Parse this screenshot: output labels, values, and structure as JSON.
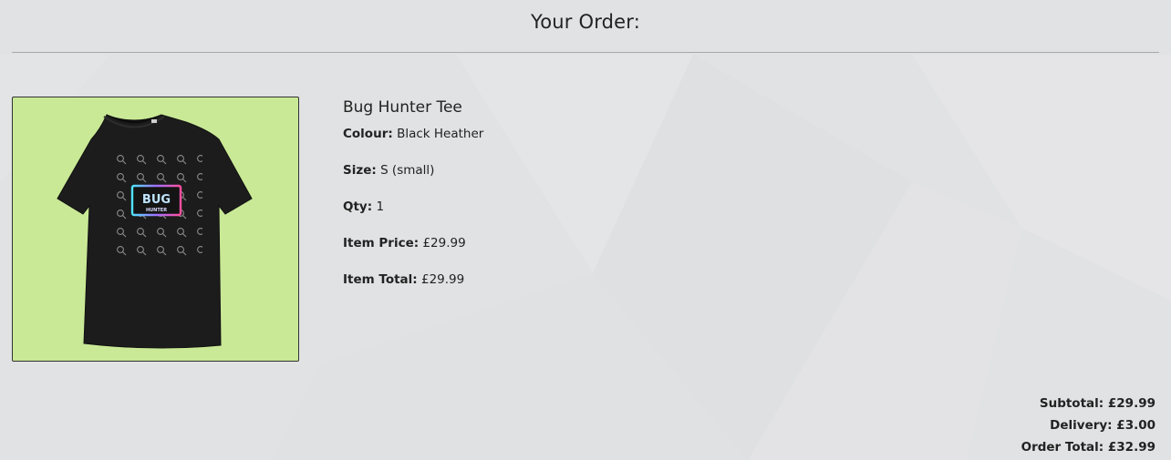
{
  "page": {
    "title": "Your Order:"
  },
  "item": {
    "name": "Bug Hunter Tee",
    "image_alt": "Bug Hunter Tee",
    "image_text_main": "BUG",
    "image_text_sub": "HUNTER",
    "image_bg_color": "#c9e996",
    "shirt_color": "#1c1c1c",
    "details": [
      {
        "label": "Colour:",
        "value": "Black Heather"
      },
      {
        "label": "Size:",
        "value": "S (small)"
      },
      {
        "label": "Qty:",
        "value": "1"
      },
      {
        "label": "Item Price:",
        "value": "£29.99"
      },
      {
        "label": "Item Total:",
        "value": "£29.99"
      }
    ]
  },
  "totals": {
    "subtotal_label": "Subtotal:",
    "subtotal_value": "£29.99",
    "delivery_label": "Delivery:",
    "delivery_value": "£3.00",
    "order_total_label": "Order Total:",
    "order_total_value": "£32.99"
  }
}
